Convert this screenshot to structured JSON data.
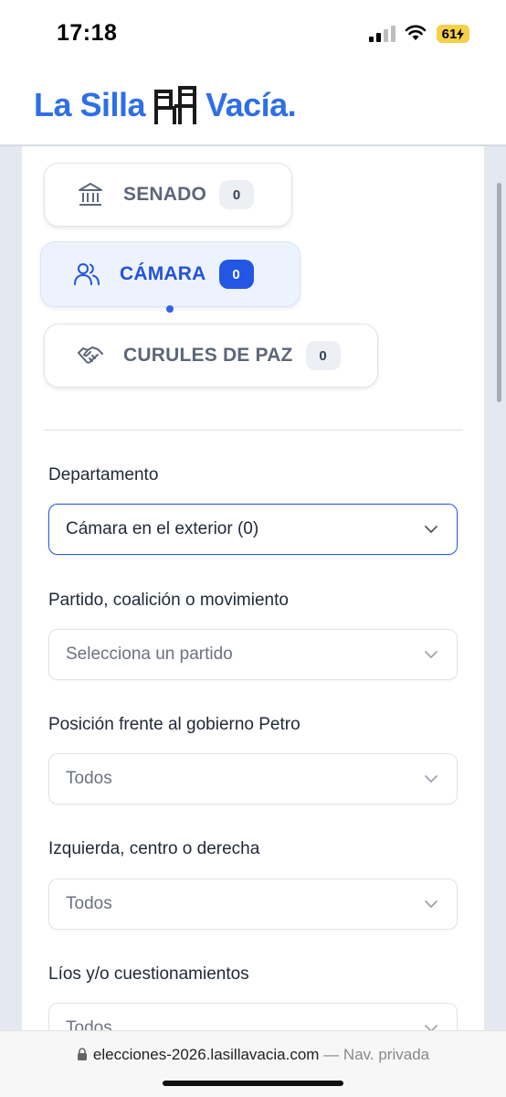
{
  "status_bar": {
    "time": "17:18",
    "battery": "61"
  },
  "header": {
    "logo_left": "La Silla",
    "logo_right": "Vacía.",
    "brand_color": "#2f6fe6"
  },
  "chambers": [
    {
      "label": "SENADO",
      "count": "0",
      "icon": "building-columns-icon",
      "active": false
    },
    {
      "label": "CÁMARA",
      "count": "0",
      "icon": "users-icon",
      "active": true
    },
    {
      "label": "CURULES DE PAZ",
      "count": "0",
      "icon": "handshake-icon",
      "active": false
    }
  ],
  "filters": [
    {
      "label": "Departamento",
      "value": "Cámara en el exterior (0)"
    },
    {
      "label": "Partido, coalición o movimiento",
      "placeholder": "Selecciona un partido"
    },
    {
      "label": "Posición frente al gobierno Petro",
      "value": "Todos"
    },
    {
      "label": "Izquierda, centro o derecha",
      "value": "Todos"
    },
    {
      "label": "Líos y/o cuestionamientos",
      "value": "Todos"
    }
  ],
  "url_bar": {
    "domain": "elecciones-2026.lasillavacia.com",
    "suffix": "— Nav. privada"
  },
  "colors": {
    "accent": "#2456e4",
    "active_bg": "#edf3fd",
    "muted": "#5c677a"
  }
}
